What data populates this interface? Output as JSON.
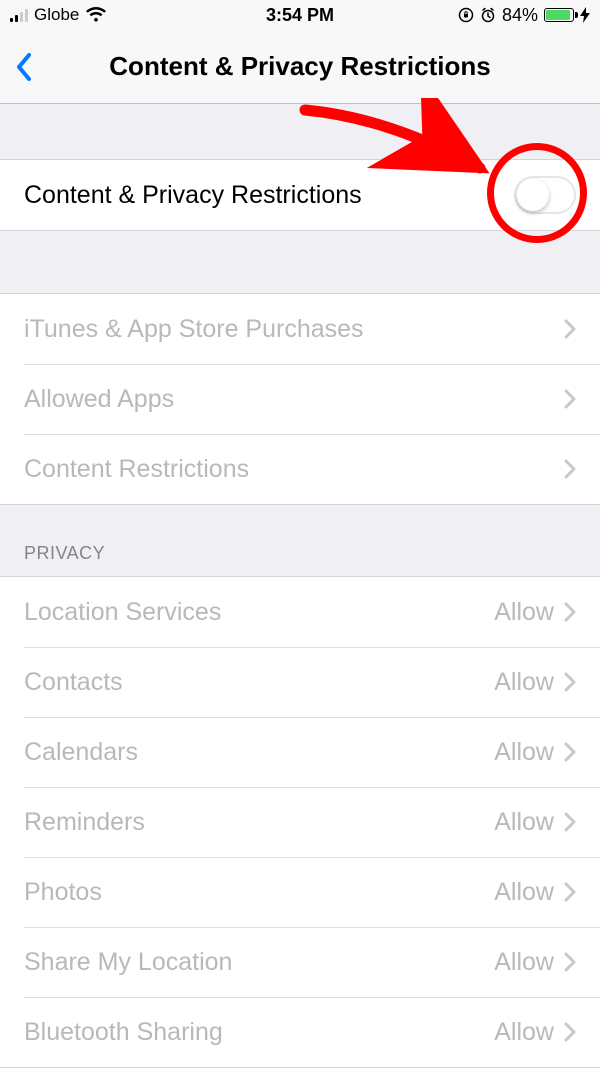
{
  "status": {
    "carrier": "Globe",
    "time": "3:54 PM",
    "battery_percent": "84%"
  },
  "nav": {
    "title": "Content & Privacy Restrictions"
  },
  "main_toggle": {
    "label": "Content & Privacy Restrictions",
    "enabled": false
  },
  "settings_group": {
    "items": [
      {
        "label": "iTunes & App Store Purchases"
      },
      {
        "label": "Allowed Apps"
      },
      {
        "label": "Content Restrictions"
      }
    ]
  },
  "privacy": {
    "header": "PRIVACY",
    "items": [
      {
        "label": "Location Services",
        "value": "Allow"
      },
      {
        "label": "Contacts",
        "value": "Allow"
      },
      {
        "label": "Calendars",
        "value": "Allow"
      },
      {
        "label": "Reminders",
        "value": "Allow"
      },
      {
        "label": "Photos",
        "value": "Allow"
      },
      {
        "label": "Share My Location",
        "value": "Allow"
      },
      {
        "label": "Bluetooth Sharing",
        "value": "Allow"
      }
    ]
  }
}
